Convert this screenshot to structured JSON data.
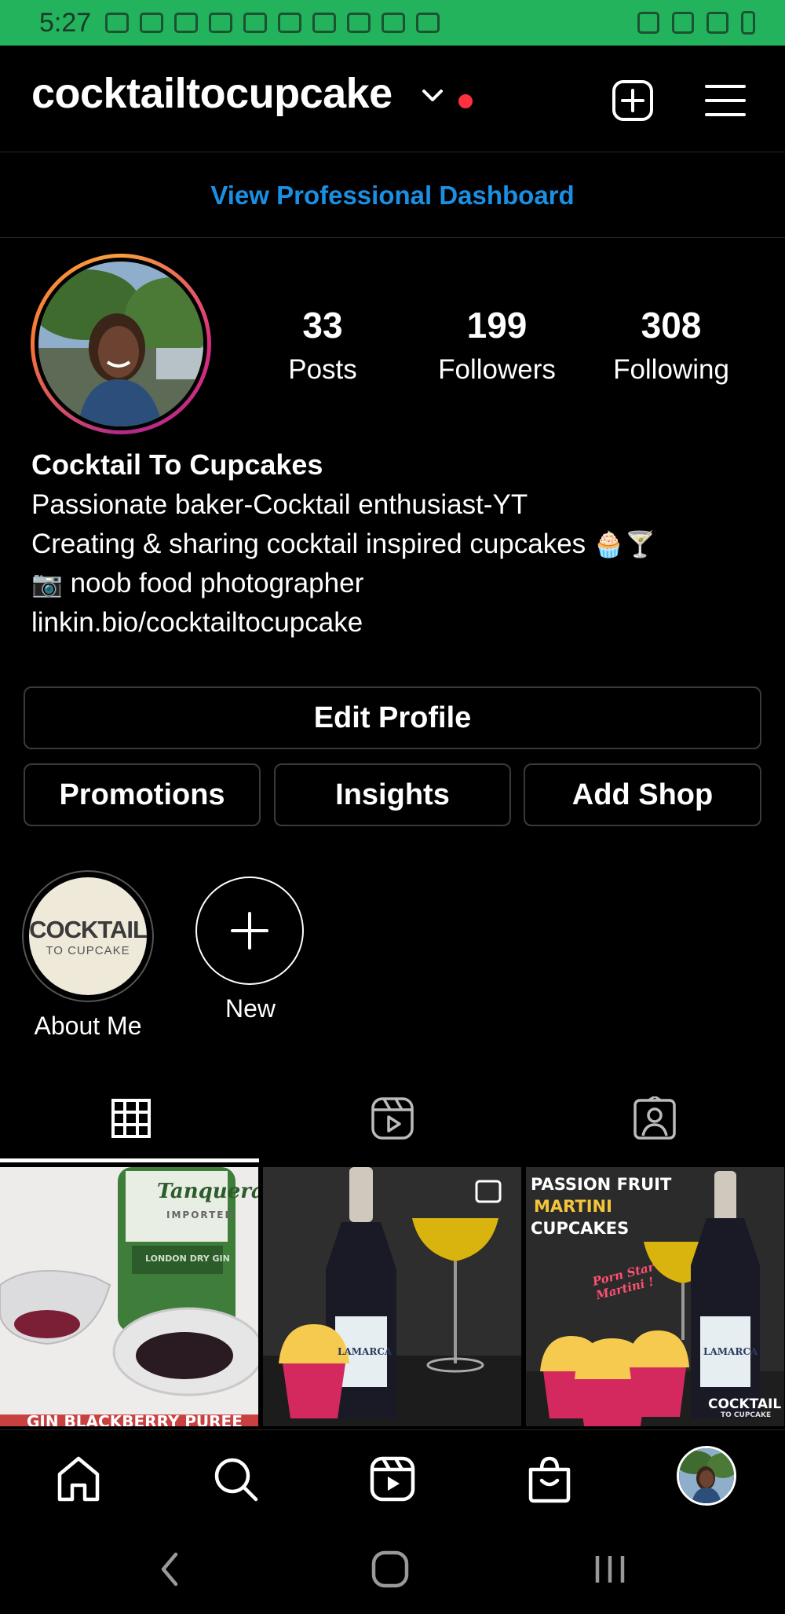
{
  "status_bar": {
    "time": "5:27",
    "background_color": "#22b35c"
  },
  "header": {
    "username": "cocktailtocupcake",
    "icons": [
      "chevron-down-icon",
      "notification-dot",
      "add-post-icon",
      "menu-icon"
    ]
  },
  "dashboard_link": "View Professional Dashboard",
  "stats": [
    {
      "value": "33",
      "label": "Posts"
    },
    {
      "value": "199",
      "label": "Followers"
    },
    {
      "value": "308",
      "label": "Following"
    }
  ],
  "bio": {
    "name": "Cocktail To Cupcakes",
    "line1": "Passionate baker-Cocktail enthusiast-YT",
    "line2": "Creating & sharing cocktail inspired cupcakes",
    "line2_emoji": "🧁🍸",
    "line3_emoji": "📷",
    "line3": "noob food photographer",
    "link": "linkin.bio/cocktailtocupcake"
  },
  "buttons": {
    "edit_profile": "Edit Profile",
    "promotions": "Promotions",
    "insights": "Insights",
    "add_shop": "Add Shop"
  },
  "highlights": [
    {
      "label": "About Me",
      "logo_top": "COCKTAIL",
      "logo_bottom": "TO CUPCAKE"
    },
    {
      "label": "New"
    }
  ],
  "tabs": [
    "grid-icon",
    "reels-icon",
    "tagged-icon"
  ],
  "posts": [
    {
      "bottle_label": "Tanqueray",
      "bottle_sub": "IMPORTED",
      "bottle_sub2": "LONDON DRY GIN",
      "caption": "GIN BLACKBERRY PUREE"
    },
    {
      "bottle_label": "LAMARCA"
    },
    {
      "title1": "PASSION FRUIT",
      "title2": "MARTINI",
      "title3": "CUPCAKES",
      "note": "Porn Star Martini !",
      "bottle_label": "LAMARCA",
      "logo_top": "COCKTAIL",
      "logo_bottom": "TO CUPCAKE"
    }
  ],
  "bottom_nav": [
    "home-icon",
    "search-icon",
    "reels-icon",
    "shop-icon",
    "profile-avatar"
  ],
  "colors": {
    "accent_link": "#1a8fe3",
    "notification_dot": "#ff3040",
    "background": "#000000"
  }
}
